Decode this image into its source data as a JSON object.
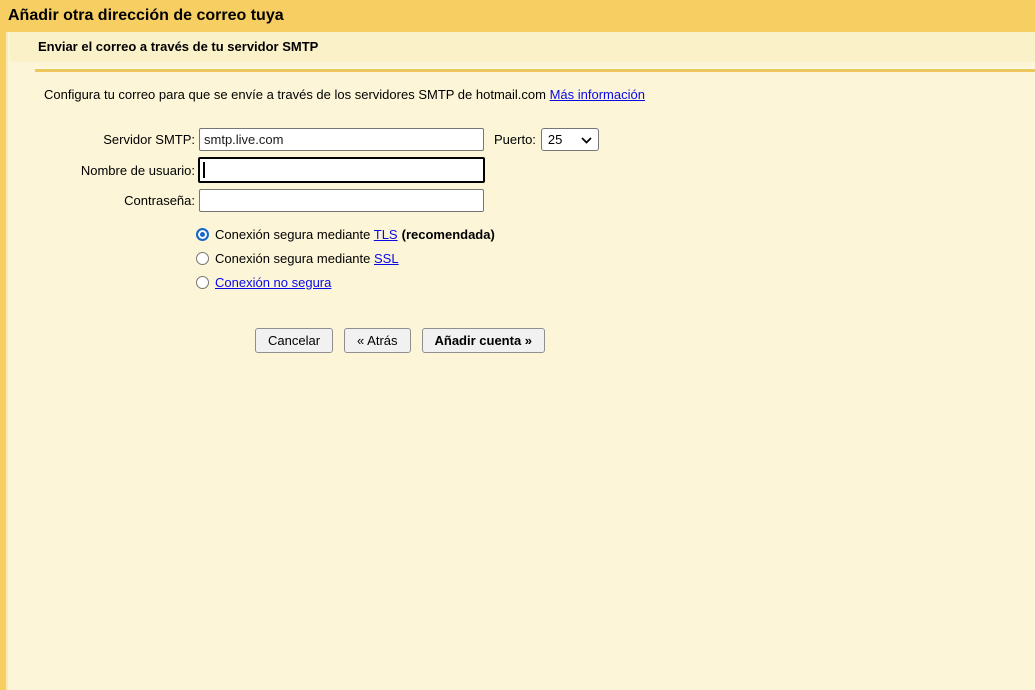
{
  "title": "Añadir otra dirección de correo tuya",
  "subtitle": "Enviar el correo a través de tu servidor SMTP",
  "intro": {
    "text": "Configura tu correo para que se envíe a través de los servidores SMTP de hotmail.com",
    "link": "Más información"
  },
  "form": {
    "smtp_label": "Servidor SMTP:",
    "smtp_value": "smtp.live.com",
    "port_label": "Puerto:",
    "port_value": "25",
    "username_label": "Nombre de usuario:",
    "username_value": "",
    "password_label": "Contraseña:",
    "password_value": "",
    "radios": [
      {
        "text": "Conexión segura mediante ",
        "link": "TLS",
        "suffix": "(recomendada)",
        "selected": true
      },
      {
        "text": "Conexión segura mediante ",
        "link": "SSL",
        "suffix": "",
        "selected": false
      },
      {
        "text": "",
        "link": "Conexión no segura",
        "suffix": "",
        "selected": false
      }
    ]
  },
  "buttons": {
    "cancel": "Cancelar",
    "back": "« Atrás",
    "submit": "Añadir cuenta »"
  },
  "colors": {
    "gold": "#F6CE62",
    "band": "#FBF1C9",
    "body_bg": "#FCF5D8",
    "divider": "#EDC75C",
    "link": "#0909E8",
    "radio_selected": "#1767C8"
  }
}
